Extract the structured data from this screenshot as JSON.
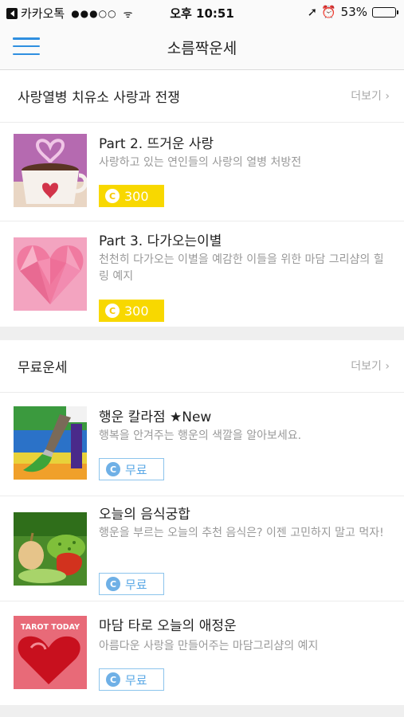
{
  "status": {
    "carrier": "카카오톡",
    "signal": "●●●○○",
    "wifi": "ᯤ",
    "time": "오후 10:51",
    "battery": "53%",
    "battery_level": 0.53,
    "right_icons": "➚ ⏰"
  },
  "nav": {
    "title": "소름짝운세"
  },
  "sections": [
    {
      "title": "사랑열병 치유소 사랑과 전쟁",
      "more": "더보기 ›",
      "items": [
        {
          "title": "Part 2. 뜨거운 사랑",
          "desc": "사랑하고 있는 연인들의 사랑의 열병 처방전",
          "price": "300",
          "coin": "C",
          "icon": "coffee-heart-icon"
        },
        {
          "title": "Part 3. 다가오는이별",
          "desc": "천천히 다가오는 이별을 예감한 이들을 위한 마담 그리샴의 힐링 예지",
          "price": "300",
          "coin": "C",
          "icon": "pink-heart-icon"
        }
      ]
    },
    {
      "title": "무료운세",
      "more": "더보기 ›",
      "items": [
        {
          "title": "행운 칼라점 ★New",
          "desc": "행복을 안겨주는 행운의 색깔을 알아보세요.",
          "price": "무료",
          "coin": "C",
          "icon": "paint-brush-icon"
        },
        {
          "title": "오늘의 음식궁합",
          "desc": "행운을 부르는 오늘의 추천 음식은? 이젠 고민하지 말고 먹자!",
          "price": "무료",
          "coin": "C",
          "icon": "vegetables-icon"
        },
        {
          "title": "마담 타로 오늘의 애정운",
          "desc": "아름다운 사랑을 만들어주는 마담그리샴의 예지",
          "price": "무료",
          "coin": "C",
          "icon": "tarot-heart-icon",
          "badge": "TAROT TODAY"
        }
      ]
    }
  ],
  "colors": {
    "accent": "#2f8fe0",
    "paid": "#f8d800",
    "free_border": "#8cc4ec"
  }
}
